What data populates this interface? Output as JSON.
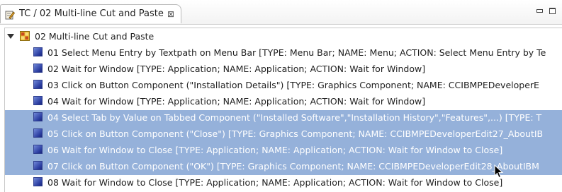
{
  "tab": {
    "title": "TC / 02 Multi-line Cut and Paste",
    "close_glyph": "⊠",
    "icon": "testcase-editor-icon"
  },
  "window_controls": {
    "minimize": "minimize-icon",
    "maximize": "maximize-icon"
  },
  "tree": {
    "root": {
      "label": "02 Multi-line Cut and Paste",
      "icon": "test-case-icon",
      "expanded": true
    },
    "children": [
      {
        "label": "01 Select Menu Entry by Textpath on Menu Bar [TYPE: Menu Bar; NAME: Menu; ACTION: Select Menu Entry by Te",
        "selected": false
      },
      {
        "label": "02 Wait for Window [TYPE: Application; NAME: Application; ACTION: Wait for Window]",
        "selected": false
      },
      {
        "label": "03 Click on Button Component (\"Installation Details\") [TYPE: Graphics Component; NAME: CCIBMPEDeveloperE",
        "selected": false
      },
      {
        "label": "04 Wait for Window [TYPE: Application; NAME: Application; ACTION: Wait for Window]",
        "selected": false
      },
      {
        "label": "04 Select Tab by Value on Tabbed Component (\"Installed Software\",\"Installation History\",\"Features\",...) [TYPE: T",
        "selected": true
      },
      {
        "label": "05 Click on Button Component (\"Close\") [TYPE: Graphics Component; NAME: CCIBMPEDeveloperEdit27_AboutIB",
        "selected": true
      },
      {
        "label": "06 Wait for Window to Close [TYPE: Application; NAME: Application; ACTION: Wait for Window to Close]",
        "selected": true
      },
      {
        "label": "07 Click on Button Component (\"OK\") [TYPE: Graphics Component; NAME: CCIBMPEDeveloperEdit28_AboutIBM",
        "selected": true
      },
      {
        "label": "08 Wait for Window to Close [TYPE: Application; NAME: Application; ACTION: Wait for Window to Close]",
        "selected": false
      }
    ]
  },
  "colors": {
    "selection": "#95b1da",
    "step_icon": "#2b3da0"
  }
}
